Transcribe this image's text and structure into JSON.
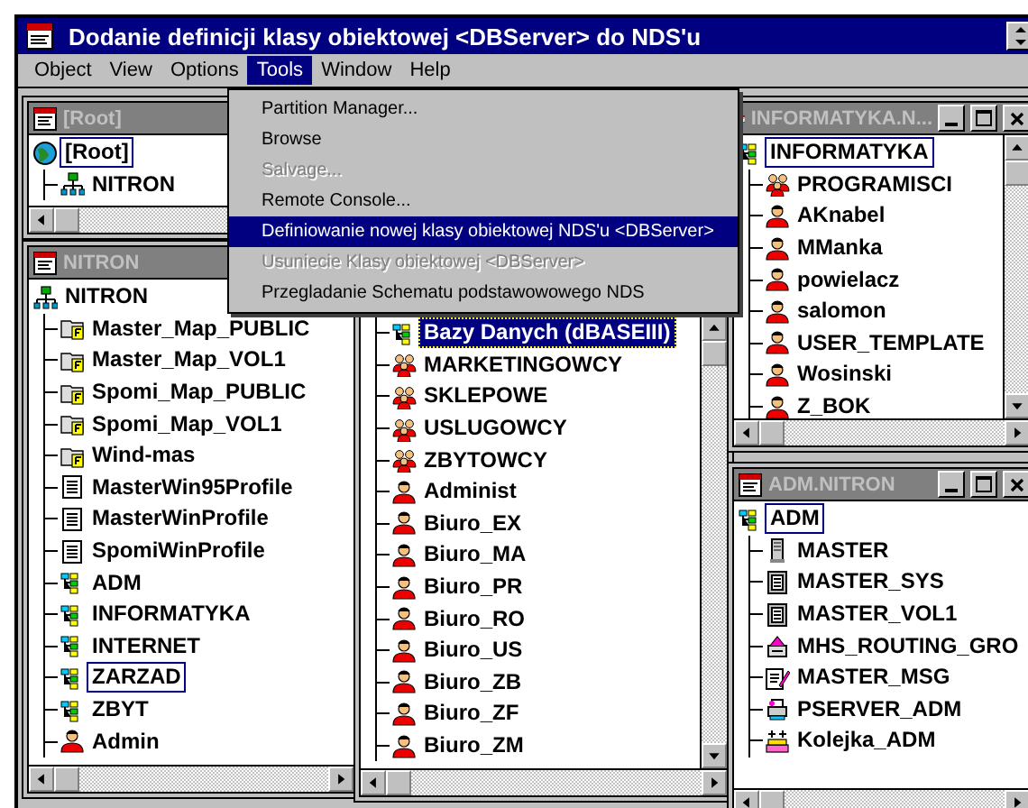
{
  "window": {
    "title": "Dodanie definicji klasy obiektowej <DBServer> do NDS'u"
  },
  "menu_bar": [
    {
      "label": "Object",
      "selected": false
    },
    {
      "label": "View",
      "selected": false
    },
    {
      "label": "Options",
      "selected": false
    },
    {
      "label": "Tools",
      "selected": true
    },
    {
      "label": "Window",
      "selected": false
    },
    {
      "label": "Help",
      "selected": false
    }
  ],
  "tools_menu": [
    {
      "label": "Partition Manager...",
      "disabled": false,
      "selected": false
    },
    {
      "label": "Browse",
      "disabled": false,
      "selected": false
    },
    {
      "label": "Salvage...",
      "disabled": true,
      "selected": false
    },
    {
      "label": "Remote Console...",
      "disabled": false,
      "selected": false
    },
    {
      "label": "Definiowanie nowej klasy obiektowej NDS'u <DBServer>",
      "disabled": false,
      "selected": true
    },
    {
      "label": "Usuniecie Klasy obiektowej <DBServer>",
      "disabled": true,
      "selected": false
    },
    {
      "label": "Przegladanie Schematu podstawowowego NDS",
      "disabled": false,
      "selected": false
    }
  ],
  "child_windows": [
    {
      "title": "[Root]",
      "vertical_scrollbar": false,
      "items": [
        {
          "label": "[Root]",
          "kind": "globe",
          "selected": false,
          "focused": true,
          "children": [
            {
              "label": "NITRON",
              "kind": "network",
              "selected": false,
              "focused": false
            }
          ]
        }
      ]
    },
    {
      "title": "NITRON",
      "vertical_scrollbar": false,
      "items": [
        {
          "label": "NITRON",
          "kind": "network",
          "selected": false,
          "focused": false,
          "children": [
            {
              "label": "Master_Map_PUBLIC",
              "kind": "map",
              "selected": false,
              "focused": false
            },
            {
              "label": "Master_Map_VOL1",
              "kind": "map",
              "selected": false,
              "focused": false
            },
            {
              "label": "Spomi_Map_PUBLIC",
              "kind": "map",
              "selected": false,
              "focused": false
            },
            {
              "label": "Spomi_Map_VOL1",
              "kind": "map",
              "selected": false,
              "focused": false
            },
            {
              "label": "Wind-mas",
              "kind": "map",
              "selected": false,
              "focused": false
            },
            {
              "label": "MasterWin95Profile",
              "kind": "profile",
              "selected": false,
              "focused": false
            },
            {
              "label": "MasterWinProfile",
              "kind": "profile",
              "selected": false,
              "focused": false
            },
            {
              "label": "SpomiWinProfile",
              "kind": "profile",
              "selected": false,
              "focused": false
            },
            {
              "label": "ADM",
              "kind": "ou",
              "selected": false,
              "focused": false
            },
            {
              "label": "INFORMATYKA",
              "kind": "ou",
              "selected": false,
              "focused": false
            },
            {
              "label": "INTERNET",
              "kind": "ou",
              "selected": false,
              "focused": false
            },
            {
              "label": "ZARZAD",
              "kind": "ou",
              "selected": false,
              "focused": true
            },
            {
              "label": "ZBYT",
              "kind": "ou",
              "selected": false,
              "focused": false
            },
            {
              "label": "Admin",
              "kind": "user",
              "selected": false,
              "focused": false
            }
          ]
        }
      ]
    },
    {
      "vertical_scrollbar": true,
      "items": [
        {
          "children": [
            {
              "label": "Bazy Danych (dBASEIII)",
              "kind": "ou",
              "selected": true,
              "focused": true
            },
            {
              "label": "MARKETINGOWCY",
              "kind": "group",
              "selected": false,
              "focused": false
            },
            {
              "label": "SKLEPOWE",
              "kind": "group",
              "selected": false,
              "focused": false
            },
            {
              "label": "USLUGOWCY",
              "kind": "group",
              "selected": false,
              "focused": false
            },
            {
              "label": "ZBYTOWCY",
              "kind": "group",
              "selected": false,
              "focused": false
            },
            {
              "label": "Administ",
              "kind": "user",
              "selected": false,
              "focused": false
            },
            {
              "label": "Biuro_EX",
              "kind": "user",
              "selected": false,
              "focused": false
            },
            {
              "label": "Biuro_MA",
              "kind": "user",
              "selected": false,
              "focused": false
            },
            {
              "label": "Biuro_PR",
              "kind": "user",
              "selected": false,
              "focused": false
            },
            {
              "label": "Biuro_RO",
              "kind": "user",
              "selected": false,
              "focused": false
            },
            {
              "label": "Biuro_US",
              "kind": "user",
              "selected": false,
              "focused": false
            },
            {
              "label": "Biuro_ZB",
              "kind": "user",
              "selected": false,
              "focused": false
            },
            {
              "label": "Biuro_ZF",
              "kind": "user",
              "selected": false,
              "focused": false
            },
            {
              "label": "Biuro_ZM",
              "kind": "user",
              "selected": false,
              "focused": false
            }
          ]
        }
      ]
    },
    {
      "title": "INFORMATYKA.N...",
      "vertical_scrollbar": true,
      "items": [
        {
          "label": "INFORMATYKA",
          "kind": "ou",
          "selected": false,
          "focused": true,
          "children": [
            {
              "label": "PROGRAMISCI",
              "kind": "group",
              "selected": false,
              "focused": false
            },
            {
              "label": "AKnabel",
              "kind": "user",
              "selected": false,
              "focused": false
            },
            {
              "label": "MManka",
              "kind": "user",
              "selected": false,
              "focused": false
            },
            {
              "label": "powielacz",
              "kind": "user",
              "selected": false,
              "focused": false
            },
            {
              "label": "salomon",
              "kind": "user",
              "selected": false,
              "focused": false
            },
            {
              "label": "USER_TEMPLATE",
              "kind": "user",
              "selected": false,
              "focused": false
            },
            {
              "label": "Wosinski",
              "kind": "user",
              "selected": false,
              "focused": false
            },
            {
              "label": "Z_BOK",
              "kind": "user",
              "selected": false,
              "focused": false
            }
          ]
        }
      ]
    },
    {
      "title": "ADM.NITRON",
      "vertical_scrollbar": false,
      "items": [
        {
          "label": "ADM",
          "kind": "ou",
          "selected": false,
          "focused": true,
          "children": [
            {
              "label": "MASTER",
              "kind": "server",
              "selected": false,
              "focused": false
            },
            {
              "label": "MASTER_SYS",
              "kind": "volume",
              "selected": false,
              "focused": false
            },
            {
              "label": "MASTER_VOL1",
              "kind": "volume",
              "selected": false,
              "focused": false
            },
            {
              "label": "MHS_ROUTING_GRO",
              "kind": "routing",
              "selected": false,
              "focused": false
            },
            {
              "label": "MASTER_MSG",
              "kind": "message",
              "selected": false,
              "focused": false
            },
            {
              "label": "PSERVER_ADM",
              "kind": "printserver",
              "selected": false,
              "focused": false
            },
            {
              "label": "Kolejka_ADM",
              "kind": "queue",
              "selected": false,
              "focused": false
            }
          ]
        }
      ]
    }
  ]
}
